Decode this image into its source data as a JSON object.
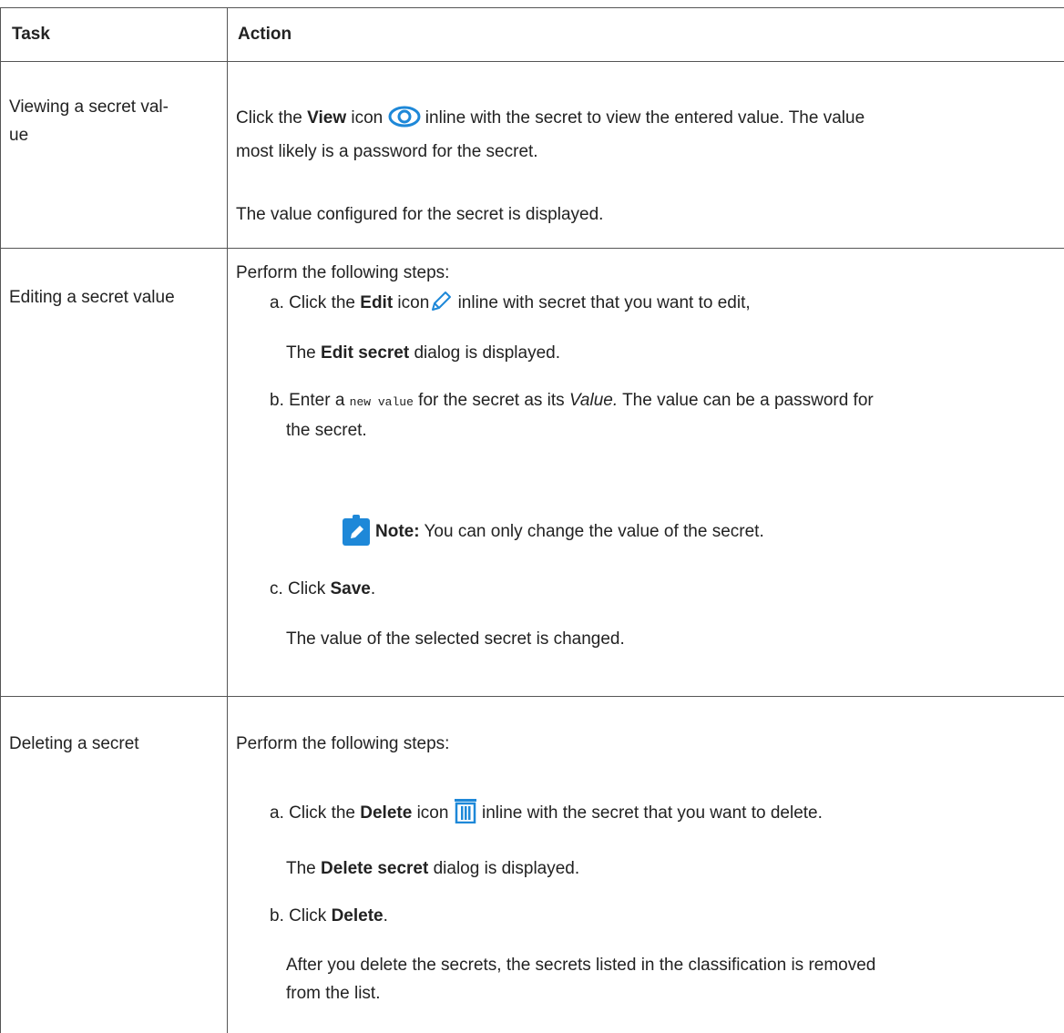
{
  "header": {
    "task": "Task",
    "action": "Action"
  },
  "rows": [
    {
      "task": "Viewing a secret val-",
      "task_cont": "ue",
      "line1_pre": "Click the ",
      "line1_bold": "View",
      "line1_mid": " icon ",
      "line1_post": " inline with the secret to view the entered value. The value",
      "line2": "most likely is a password for the secret.",
      "result": "The value configured for the secret is displayed."
    },
    {
      "task": "Editing a secret value",
      "intro": "Perform the following steps:",
      "a_pre": "a. Click the ",
      "a_bold": "Edit",
      "a_mid": " icon",
      "a_post": " inline with secret that you want to edit,",
      "a_res_pre": "The ",
      "a_res_bold": "Edit secret",
      "a_res_post": " dialog is displayed.",
      "b_pre": "b. Enter a ",
      "b_code": "new value",
      "b_mid": " for the secret as its ",
      "b_italic": "Value.",
      "b_post": " The value can be a password for",
      "b_line2": "the secret.",
      "note_label": "Note:",
      "note_text": " You can only change the value of the secret.",
      "c_pre": "c. Click ",
      "c_bold": "Save",
      "c_post": ".",
      "c_res": "The value of the selected secret is changed."
    },
    {
      "task": "Deleting a secret",
      "intro": "Perform the following steps:",
      "a_pre": "a. Click the ",
      "a_bold": "Delete",
      "a_mid": " icon ",
      "a_post": " inline with the secret that you want to delete.",
      "a_res_pre": "The ",
      "a_res_bold": "Delete secret",
      "a_res_post": " dialog is displayed.",
      "b_pre": "b. Click ",
      "b_bold": "Delete",
      "b_post": ".",
      "b_res1": "After you delete the secrets, the secrets listed in the classification is removed",
      "b_res2": "from the list."
    }
  ],
  "colors": {
    "icon_blue": "#1e88d8",
    "border": "#555555",
    "text": "#222222"
  }
}
